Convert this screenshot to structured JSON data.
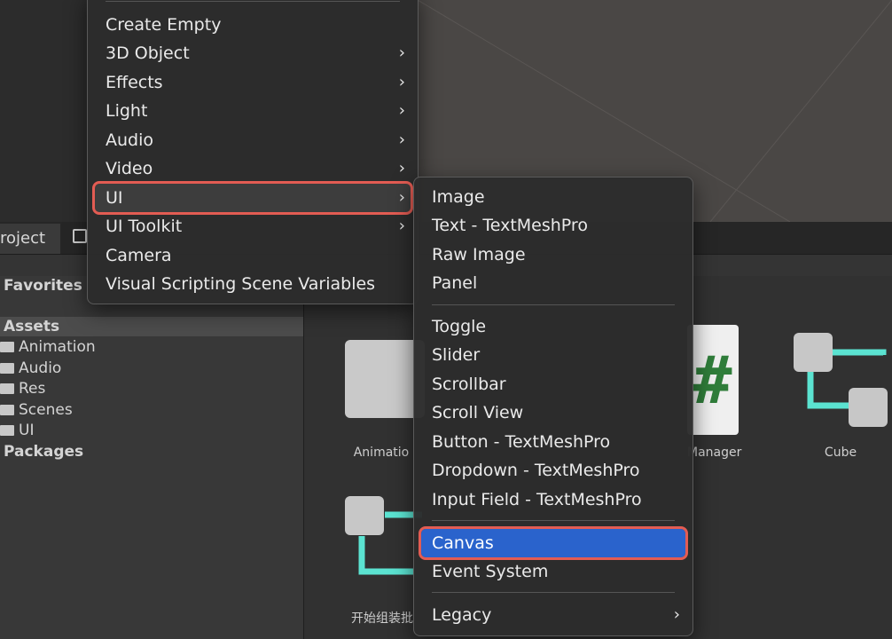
{
  "main_menu": {
    "items": [
      {
        "label": "Create Empty",
        "submenu": false
      },
      {
        "label": "3D Object",
        "submenu": true
      },
      {
        "label": "Effects",
        "submenu": true
      },
      {
        "label": "Light",
        "submenu": true
      },
      {
        "label": "Audio",
        "submenu": true
      },
      {
        "label": "Video",
        "submenu": true
      },
      {
        "label": "UI",
        "submenu": true
      },
      {
        "label": "UI Toolkit",
        "submenu": true
      },
      {
        "label": "Camera",
        "submenu": false
      },
      {
        "label": "Visual Scripting Scene Variables",
        "submenu": false
      }
    ],
    "highlighted": "UI"
  },
  "ui_submenu": {
    "group1": [
      "Image",
      "Text - TextMeshPro",
      "Raw Image",
      "Panel"
    ],
    "group2": [
      "Toggle",
      "Slider",
      "Scrollbar",
      "Scroll View",
      "Button - TextMeshPro",
      "Dropdown - TextMeshPro",
      "Input Field - TextMeshPro"
    ],
    "group3": [
      "Canvas",
      "Event System"
    ],
    "group4": [
      "Legacy"
    ],
    "selected": "Canvas"
  },
  "project": {
    "tab_label": "roject",
    "favorites": "Favorites",
    "tree": {
      "assets": "Assets",
      "folders": [
        "Animation",
        "Audio",
        "Res",
        "Scenes",
        "UI"
      ],
      "packages": "Packages"
    },
    "assets": {
      "animation_label": "Animatio",
      "manager_label": "Manager",
      "cube_label": "Cube",
      "start_label": "开始组装批"
    }
  },
  "glyphs": {
    "chevron": "›",
    "hash": "#"
  },
  "colors": {
    "accent_blue": "#2a63cc",
    "highlight_red": "#e35c53",
    "prefab_cyan": "#5be3d1"
  }
}
